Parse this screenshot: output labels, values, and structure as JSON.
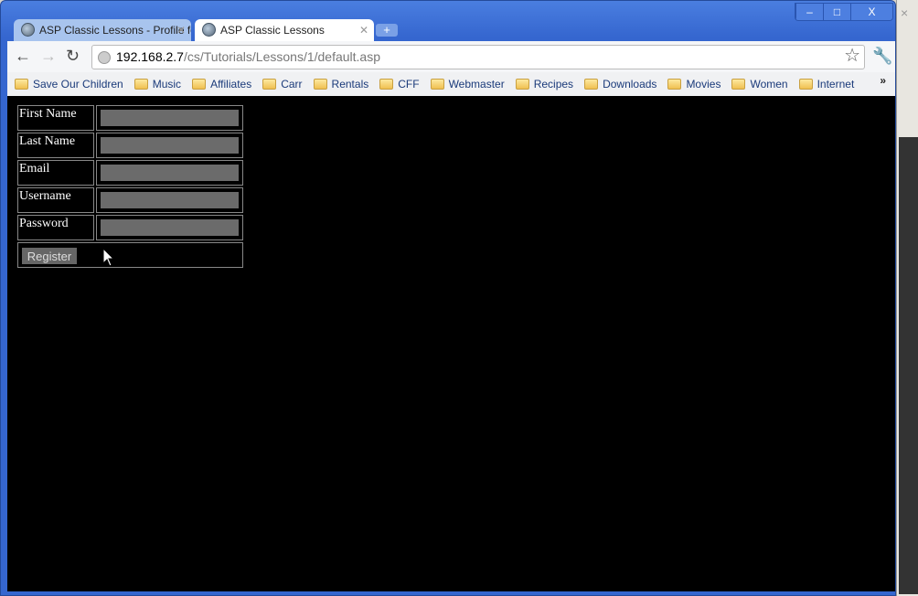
{
  "browser": {
    "tabs": [
      {
        "label": "ASP Classic Lessons - Profile fo"
      },
      {
        "label": "ASP Classic Lessons"
      }
    ],
    "address": {
      "host": "192.168.2.7",
      "path": "/cs/Tutorials/Lessons/1/default.asp"
    },
    "bookmarks": [
      "Save Our Children",
      "Music",
      "Affiliates",
      "Carr",
      "Rentals",
      "CFF",
      "Webmaster",
      "Recipes",
      "Downloads",
      "Movies",
      "Women",
      "Internet"
    ],
    "more": "»"
  },
  "form": {
    "fields": [
      {
        "label": "First Name",
        "value": ""
      },
      {
        "label": "Last Name",
        "value": ""
      },
      {
        "label": "Email",
        "value": ""
      },
      {
        "label": "Username",
        "value": ""
      },
      {
        "label": "Password",
        "value": ""
      }
    ],
    "submit_label": "Register"
  }
}
